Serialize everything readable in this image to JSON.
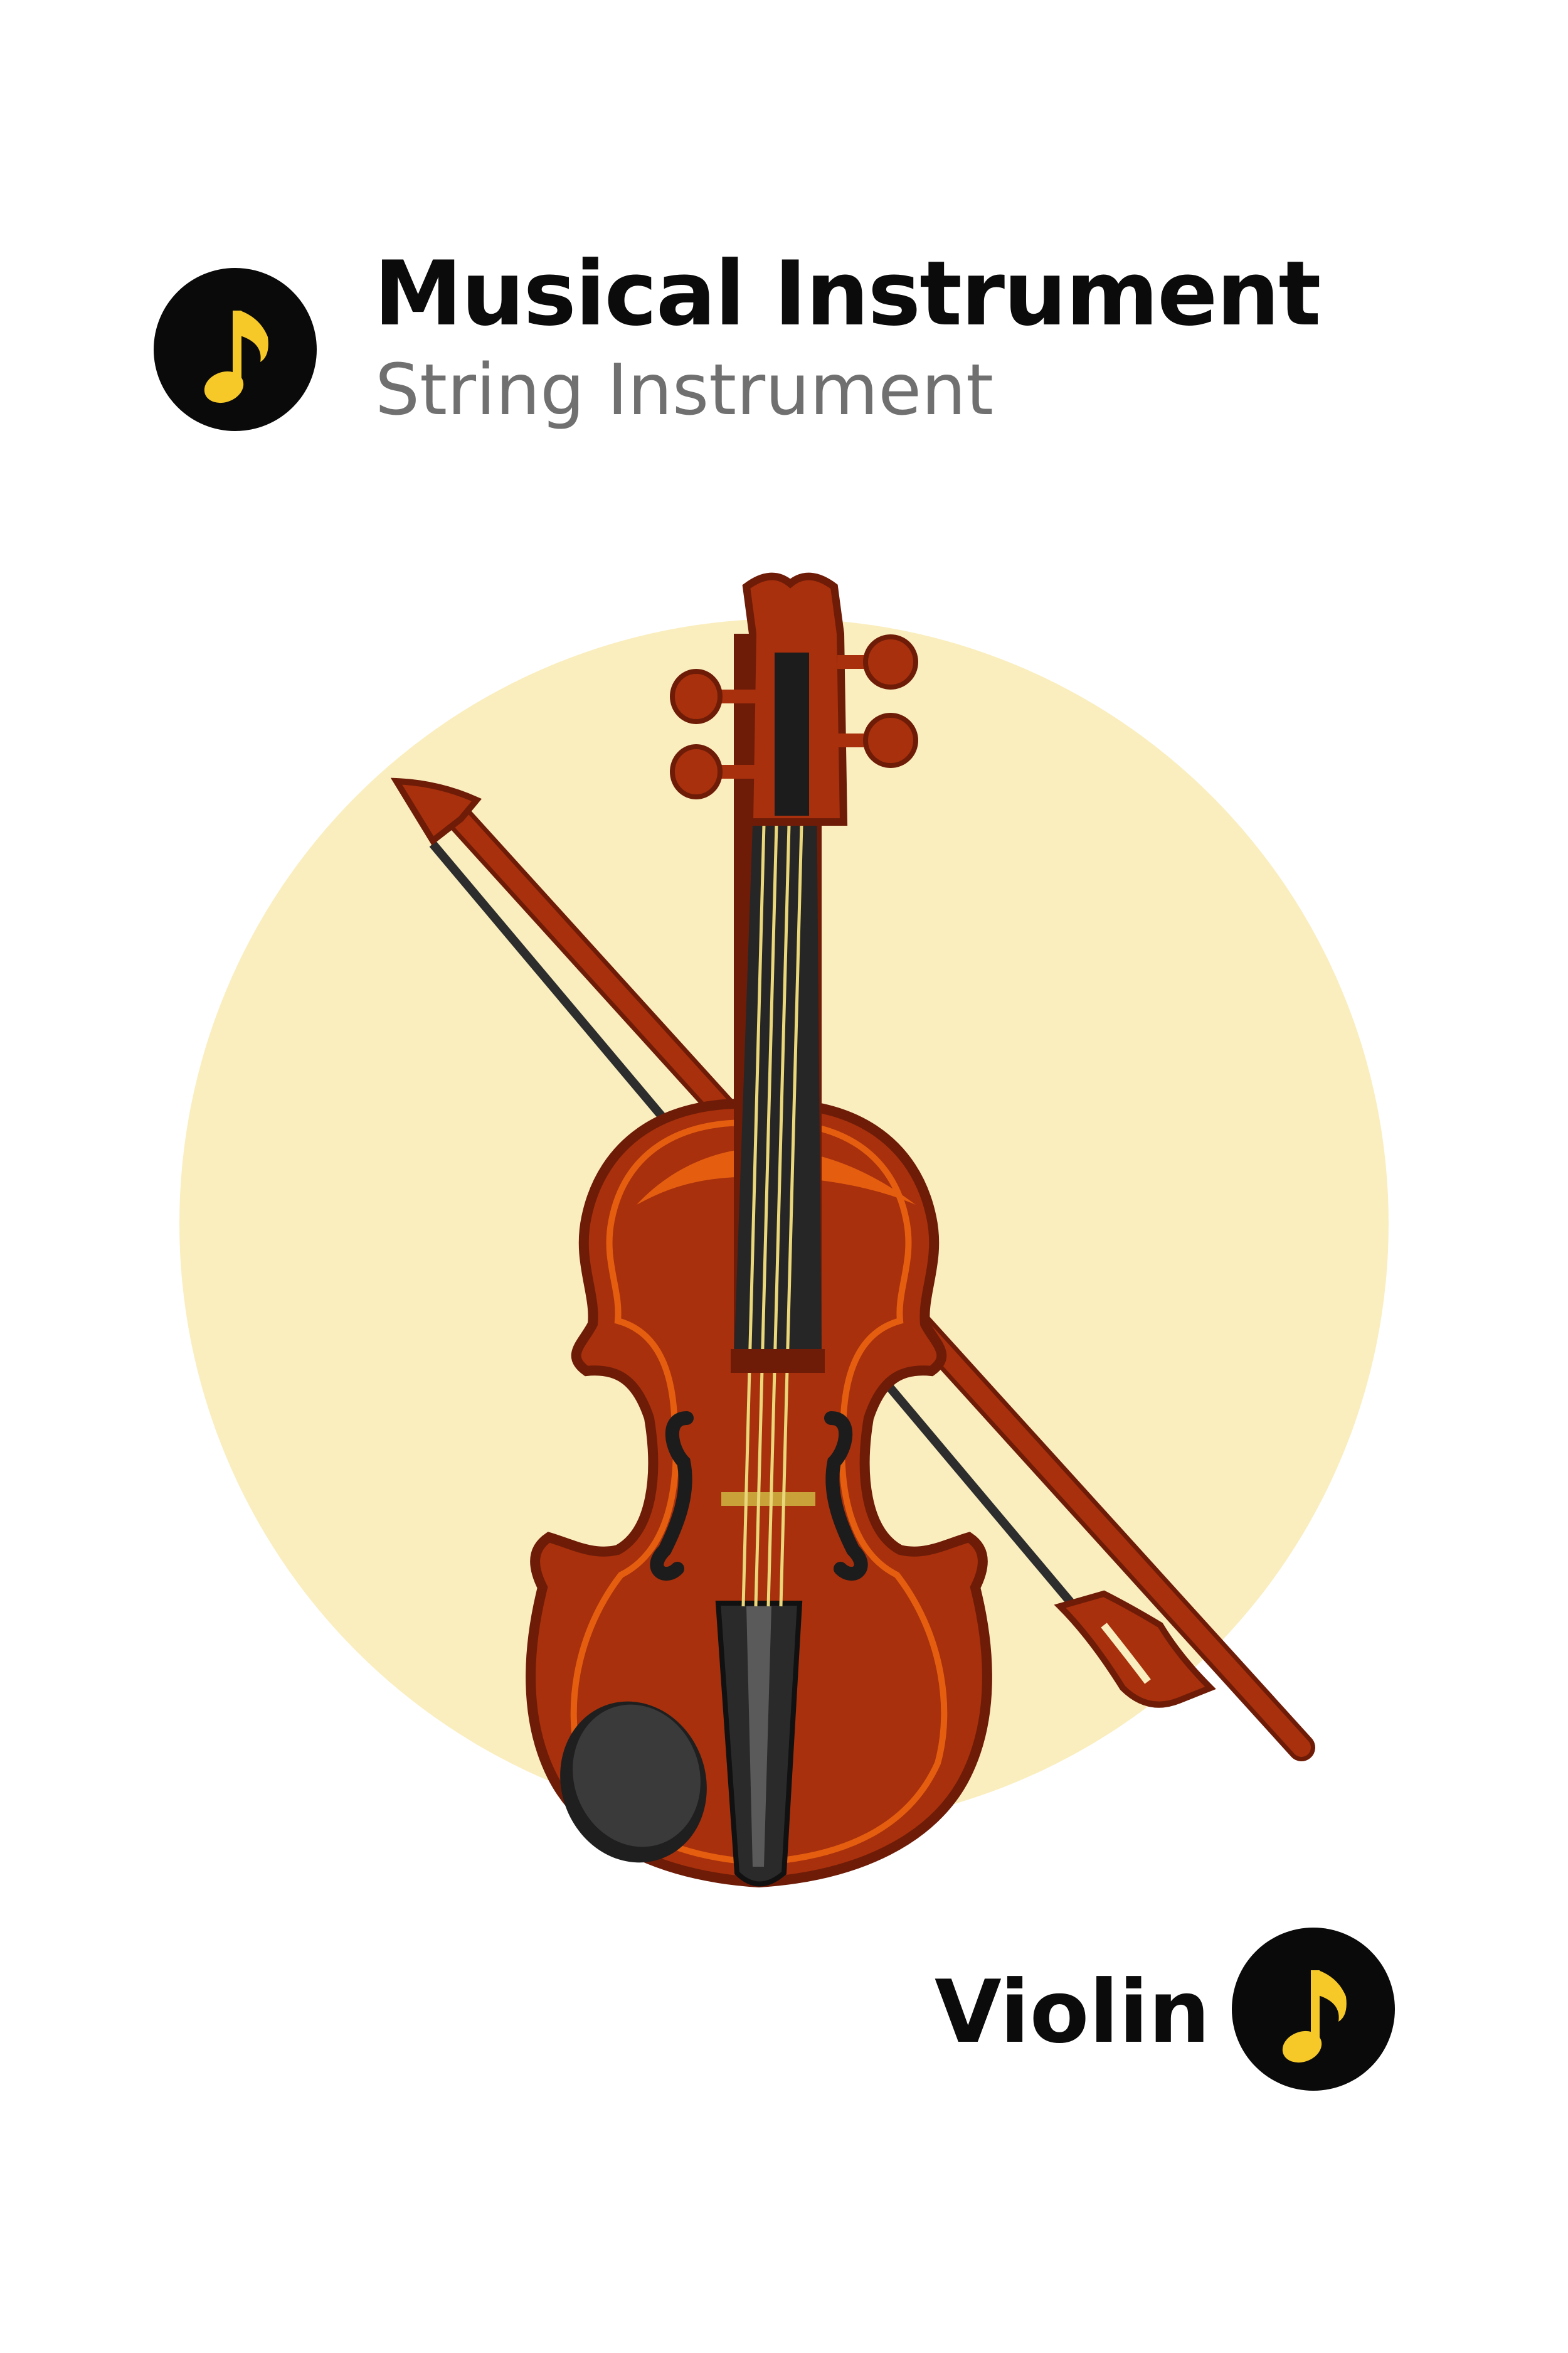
{
  "header": {
    "title": "Musical Instrument",
    "subtitle": "String Instrument",
    "icon": "music-note-icon"
  },
  "footer": {
    "name": "Violin",
    "icon": "music-note-icon"
  },
  "colors": {
    "background": "#ffffff",
    "circle": "#faeebf",
    "badge": "#0a0a0a",
    "note": "#f7c928",
    "wood": "#a8300c",
    "wood_light": "#e55e10",
    "wood_dark": "#6e1c08",
    "fingerboard": "#262626",
    "strings": "#e9d77a",
    "title_text": "#0b0b0b",
    "subtitle_text": "#707070"
  }
}
